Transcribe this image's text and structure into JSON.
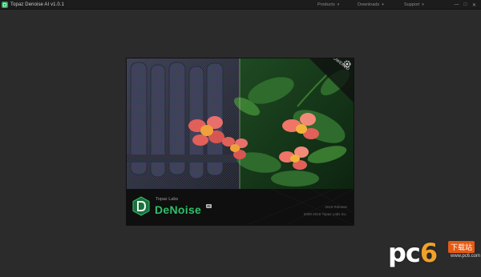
{
  "window": {
    "title": "Topaz Denoise AI v1.0.1",
    "menus": [
      {
        "label": "Products"
      },
      {
        "label": "Downloads"
      },
      {
        "label": "Support"
      }
    ],
    "controls": {
      "minimize": "—",
      "maximize": "□",
      "close": "✕"
    }
  },
  "splash": {
    "badge": "AI POWERED",
    "brand_small": "Topaz Labs",
    "brand_big": "DeNoise",
    "brand_tag": "AI",
    "release": "2019 Release",
    "copyright": "2009-2019 Topaz Labs Inc."
  },
  "watermark": {
    "logo_text_left": "pc",
    "logo_text_six": "6",
    "site_label": "下载站",
    "domain": "www.pc6.com"
  },
  "colors": {
    "brand_green": "#2fbf6a",
    "background": "#2b2b2b",
    "titlebar": "#1c1c1c"
  }
}
